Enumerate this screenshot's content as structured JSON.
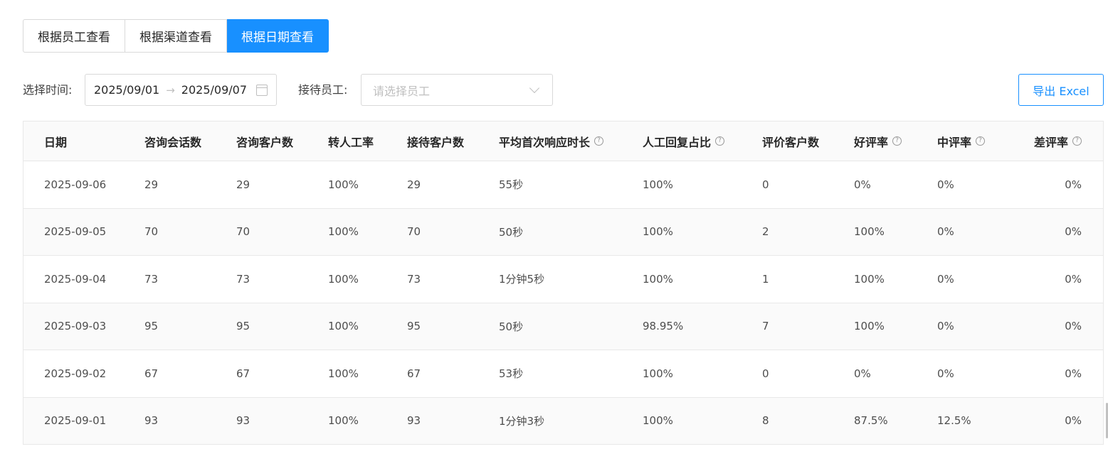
{
  "tabs": [
    {
      "label": "根据员工查看",
      "active": false
    },
    {
      "label": "根据渠道查看",
      "active": false
    },
    {
      "label": "根据日期查看",
      "active": true
    }
  ],
  "filters": {
    "time_label": "选择时间:",
    "start_date": "2025/09/01",
    "range_separator": "→",
    "end_date": "2025/09/07",
    "staff_label": "接待员工:",
    "staff_placeholder": "请选择员工",
    "export_label": "导出 Excel"
  },
  "table": {
    "columns": [
      {
        "label": "日期",
        "help": false
      },
      {
        "label": "咨询会话数",
        "help": false
      },
      {
        "label": "咨询客户数",
        "help": false
      },
      {
        "label": "转人工率",
        "help": false
      },
      {
        "label": "接待客户数",
        "help": false
      },
      {
        "label": "平均首次响应时长",
        "help": true
      },
      {
        "label": "人工回复占比",
        "help": true
      },
      {
        "label": "评价客户数",
        "help": false
      },
      {
        "label": "好评率",
        "help": true
      },
      {
        "label": "中评率",
        "help": true
      },
      {
        "label": "差评率",
        "help": true
      }
    ],
    "help_glyph": "?",
    "rows": [
      [
        "2025-09-06",
        "29",
        "29",
        "100%",
        "29",
        "55秒",
        "100%",
        "0",
        "0%",
        "0%",
        "0%"
      ],
      [
        "2025-09-05",
        "70",
        "70",
        "100%",
        "70",
        "50秒",
        "100%",
        "2",
        "100%",
        "0%",
        "0%"
      ],
      [
        "2025-09-04",
        "73",
        "73",
        "100%",
        "73",
        "1分钟5秒",
        "100%",
        "1",
        "100%",
        "0%",
        "0%"
      ],
      [
        "2025-09-03",
        "95",
        "95",
        "100%",
        "95",
        "50秒",
        "98.95%",
        "7",
        "100%",
        "0%",
        "0%"
      ],
      [
        "2025-09-02",
        "67",
        "67",
        "100%",
        "67",
        "53秒",
        "100%",
        "0",
        "0%",
        "0%",
        "0%"
      ],
      [
        "2025-09-01",
        "93",
        "93",
        "100%",
        "93",
        "1分钟3秒",
        "100%",
        "8",
        "87.5%",
        "12.5%",
        "0%"
      ]
    ]
  },
  "colors": {
    "accent": "#1890ff",
    "border": "#d9d9d9",
    "stripe": "#fafafa"
  }
}
